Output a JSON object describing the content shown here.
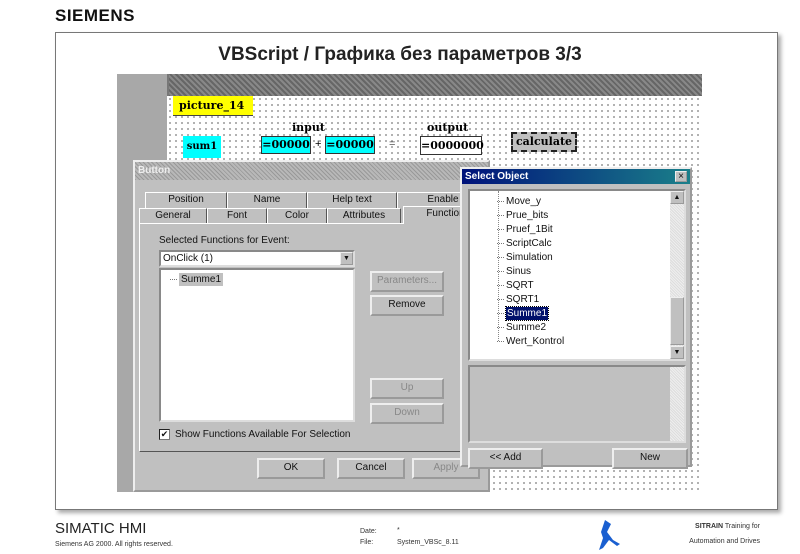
{
  "header": {
    "logo": "SIEMENS",
    "title": "VBScript /  Графика без параметров 3/3"
  },
  "canvas": {
    "picture_name": "picture_14",
    "input_label": "input",
    "output_label": "output",
    "sum_label": "sum1",
    "input1": "=00000",
    "plus": "+",
    "input2": "=00000",
    "equals": "=",
    "output_value": "=0000000",
    "calculate_label": "calculate"
  },
  "button_dialog": {
    "title": "Button",
    "tabs_row1": [
      "Position",
      "Name",
      "Help text",
      "Enable"
    ],
    "tabs_row2": [
      "General",
      "Font",
      "Color",
      "Attributes",
      "Functions"
    ],
    "event_label": "Selected Functions for Event:",
    "event_value": "OnClick  (1)",
    "functions": [
      "Summe1"
    ],
    "parameters_button": "Parameters...",
    "remove_button": "Remove",
    "up_button": "Up",
    "down_button": "Down",
    "show_functions_label": "Show Functions Available For Selection",
    "show_functions_checked": true,
    "ok_button": "OK",
    "cancel_button": "Cancel",
    "apply_button": "Apply"
  },
  "select_dialog": {
    "title": "Select Object",
    "close": "×",
    "items": [
      "Move_y",
      "Prue_bits",
      "Pruef_1Bit",
      "ScriptCalc",
      "Simulation",
      "Sinus",
      "SQRT",
      "SQRT1",
      "Summe1",
      "Summe2",
      "Wert_Kontrol"
    ],
    "selected": "Summe1",
    "add_button": "<< Add",
    "new_button": "New"
  },
  "footer": {
    "product": "SIMATIC HMI",
    "copyright": "Siemens AG 2000. All rights reserved.",
    "date_label": "Date:",
    "date_value": "*",
    "file_label": "File:",
    "file_value": "System_VBSc_8.11",
    "sitrain_bold": "SITRAIN",
    "sitrain_rest": " Training for",
    "sitrain_line2": "Automation and Drives"
  }
}
